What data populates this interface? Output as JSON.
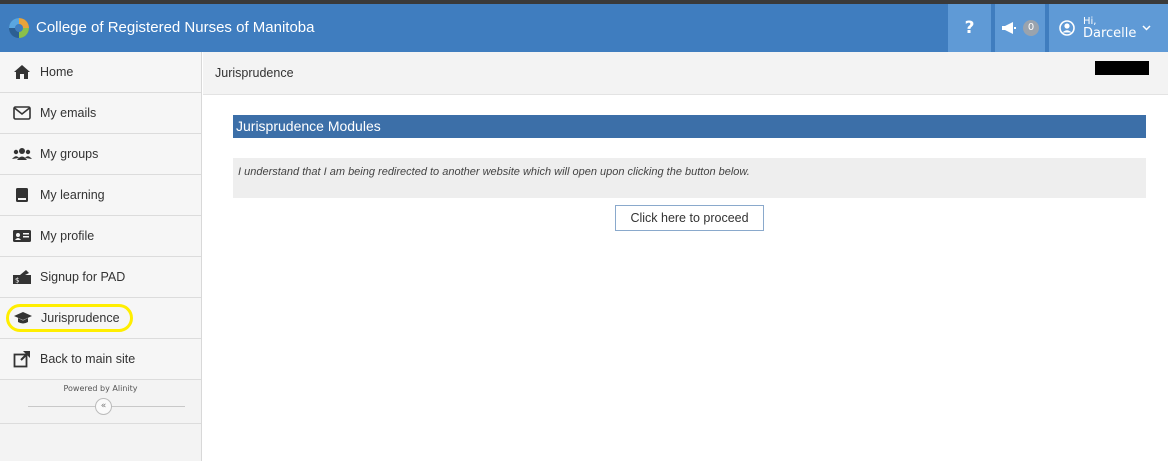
{
  "header": {
    "title": "College of Registered Nurses of Manitoba",
    "help_label": "?",
    "notification_count": "0",
    "greeting": "Hi,",
    "user_name": "Darcelle"
  },
  "sidebar": {
    "items": [
      {
        "label": "Home",
        "icon": "home-icon"
      },
      {
        "label": "My emails",
        "icon": "envelope-icon"
      },
      {
        "label": "My groups",
        "icon": "users-icon"
      },
      {
        "label": "My learning",
        "icon": "book-icon"
      },
      {
        "label": "My profile",
        "icon": "id-card-icon"
      },
      {
        "label": "Signup for PAD",
        "icon": "money-icon"
      },
      {
        "label": "Jurisprudence",
        "icon": "graduation-cap-icon"
      },
      {
        "label": "Back to main site",
        "icon": "external-link-icon"
      }
    ],
    "powered_by": "Powered by Alinity",
    "collapse_label": "«"
  },
  "breadcrumb": "Jurisprudence",
  "main": {
    "section_title": "Jurisprudence Modules",
    "notice": "I understand that I am being redirected to another website which will open upon clicking the button below.",
    "proceed_label": "Click here to proceed"
  },
  "colors": {
    "topbar": "#3f7dbf",
    "header_buttons": "#5f9ad6",
    "section_header": "#3c6fa8",
    "highlight": "#ffee00"
  }
}
